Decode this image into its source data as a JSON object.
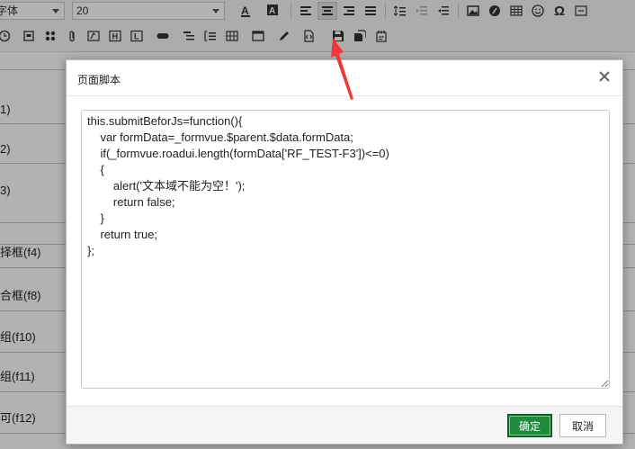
{
  "toolbar": {
    "font_family_value": "字体",
    "font_size_value": "20",
    "row1_icons": [
      "font-color-icon",
      "background-color-icon",
      "align-left-icon",
      "align-center-icon",
      "align-right-icon",
      "align-justify-icon",
      "line-height-icon",
      "indent-icon",
      "outdent-icon",
      "image-icon",
      "music-icon",
      "table-icon",
      "emoji-icon",
      "omega-icon",
      "more-icon"
    ],
    "row2_icons": [
      "clock-icon",
      "box-icon",
      "group-icon",
      "attachment-icon",
      "textarea-icon",
      "h-icon",
      "l-icon",
      "pill-icon",
      "list-icon",
      "indent-list-icon",
      "grid-icon",
      "window-icon",
      "pen-icon",
      "page-script-icon",
      "save-icon",
      "save-as-icon",
      "config-icon"
    ],
    "h_label": "H",
    "l_label": "L"
  },
  "background_form": {
    "rows": [
      "1)",
      "2)",
      "3)",
      "择框(f4)",
      "合框(f8)",
      "组(f10)",
      "组(f11)",
      "可(f12)"
    ]
  },
  "dialog": {
    "title": "页面脚本",
    "code": "this.submitBeforJs=function(){\n    var formData=_formvue.$parent.$data.formData;\n    if(_formvue.roadui.length(formData['RF_TEST-F3'])<=0)\n    {\n        alert('文本域不能为空！');\n        return false;\n    }\n    return true;\n};",
    "ok_label": "确定",
    "cancel_label": "取消"
  },
  "colors": {
    "ok_button": "#1f8a3c",
    "arrow": "#f03a3a"
  }
}
